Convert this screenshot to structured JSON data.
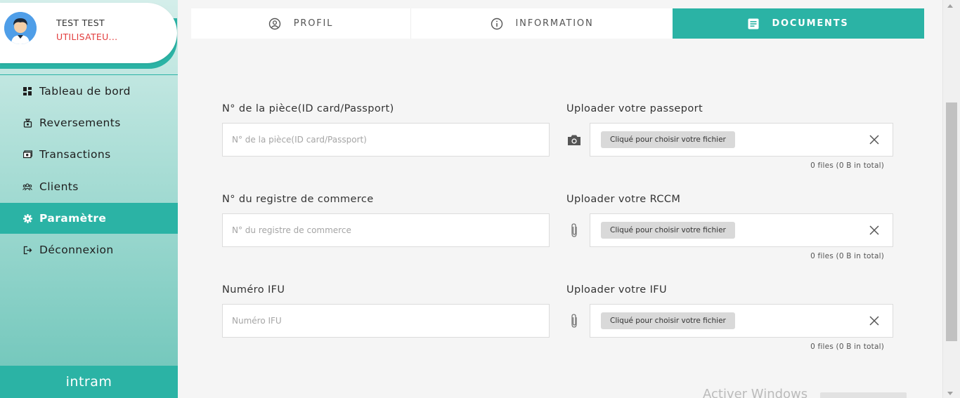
{
  "user": {
    "name": "TEST TEST",
    "role": "UTILISATEU..."
  },
  "sidebar": {
    "items": [
      {
        "label": "Tableau de bord",
        "icon": "dashboard-icon",
        "active": false
      },
      {
        "label": "Reversements",
        "icon": "money-bag-icon",
        "active": false
      },
      {
        "label": "Transactions",
        "icon": "banknote-icon",
        "active": false
      },
      {
        "label": "Clients",
        "icon": "users-icon",
        "active": false
      },
      {
        "label": "Paramètre",
        "icon": "gear-icon",
        "active": true
      },
      {
        "label": "Déconnexion",
        "icon": "logout-icon",
        "active": false
      }
    ],
    "brand": "intram"
  },
  "tabs": [
    {
      "label": "PROFIL",
      "icon": "user-circle-icon",
      "active": false
    },
    {
      "label": "INFORMATION",
      "icon": "info-circle-icon",
      "active": false
    },
    {
      "label": "DOCUMENTS",
      "icon": "document-icon",
      "active": true
    }
  ],
  "form": {
    "id_number": {
      "label": "N° de la pièce(ID card/Passport)",
      "placeholder": "N° de la pièce(ID card/Passport)",
      "value": ""
    },
    "rccm_number": {
      "label": "N° du registre de commerce",
      "placeholder": "N° du registre de commerce",
      "value": ""
    },
    "ifu_number": {
      "label": "Numéro IFU",
      "placeholder": "Numéro IFU",
      "value": ""
    }
  },
  "uploads": {
    "passport": {
      "label": "Uploader votre passeport",
      "button": "Cliqué pour choisir votre fichier",
      "count": "0 files (0 B in total)",
      "icon": "camera-icon"
    },
    "rccm": {
      "label": "Uploader votre RCCM",
      "button": "Cliqué pour choisir votre fichier",
      "count": "0 files (0 B in total)",
      "icon": "paperclip-icon"
    },
    "ifu": {
      "label": "Uploader votre IFU",
      "button": "Cliqué pour choisir votre fichier",
      "count": "0 files (0 B in total)",
      "icon": "paperclip-icon"
    }
  },
  "watermark": "Activer Windows",
  "colors": {
    "accent": "#2bb3a5",
    "role": "#e23b3b"
  }
}
